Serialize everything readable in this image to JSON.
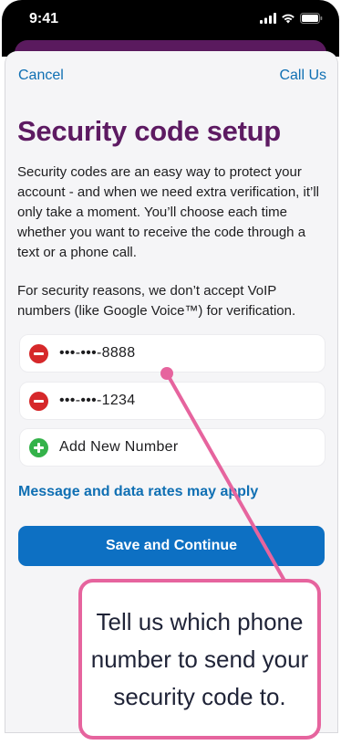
{
  "status_bar": {
    "time": "9:41"
  },
  "nav": {
    "cancel_label": "Cancel",
    "call_label": "Call Us"
  },
  "title": "Security code setup",
  "description": "Security codes are an easy way to protect your account - and when we need extra verification, it’ll only take a moment. You’ll choose each time whether you want to receive the code through a text or a phone call.",
  "voip_notice": "For security reasons, we don’t accept VoIP numbers (like Google Voice™) for verification.",
  "phone_numbers": [
    {
      "masked": "•••-•••-8888",
      "action_icon": "minus-circle-icon"
    },
    {
      "masked": "•••-•••-1234",
      "action_icon": "minus-circle-icon"
    }
  ],
  "add_number_label": "Add New Number",
  "rates_link": "Message and data rates may apply",
  "primary_button": "Save and Continue",
  "callout": {
    "text": "Tell us which phone number to send your security code to.",
    "color": "#e6649e"
  },
  "colors": {
    "brand_purple": "#5d1a62",
    "link_blue": "#0f6fb3",
    "button_blue": "#0d70c3",
    "remove_red": "#d6282a",
    "add_green": "#34b24a"
  }
}
